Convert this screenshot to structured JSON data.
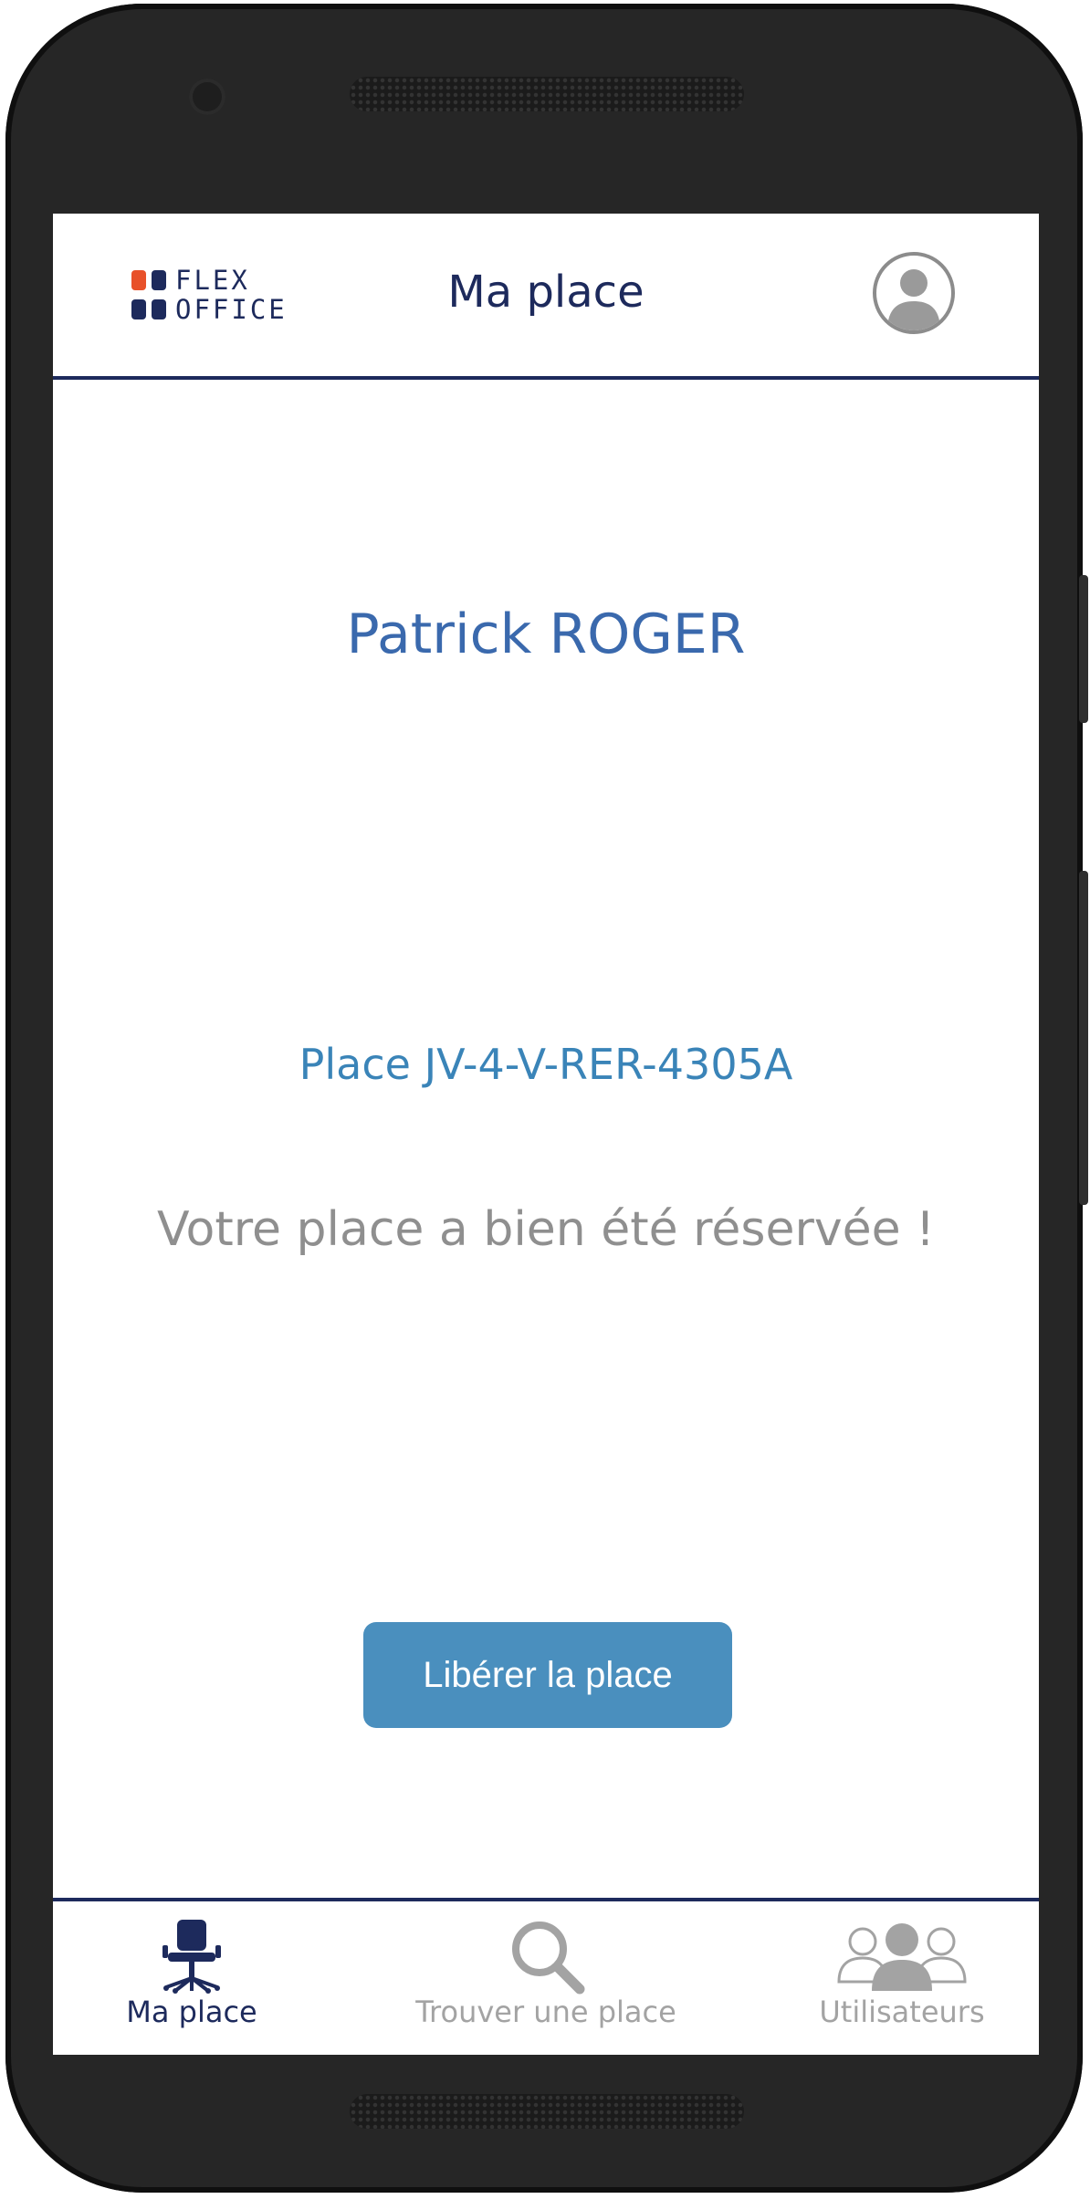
{
  "app": {
    "logo_line1": "FLEX",
    "logo_line2": "OFFICE"
  },
  "header": {
    "title": "Ma place",
    "avatar_icon": "user-avatar-icon"
  },
  "main": {
    "user_name": "Patrick ROGER",
    "place_label": "Place JV-4-V-RER-4305A",
    "status_message": "Votre place a bien été réservée !",
    "release_button_label": "Libérer la place"
  },
  "bottom_nav": {
    "items": [
      {
        "label": "Ma place",
        "icon": "office-chair-icon",
        "active": true
      },
      {
        "label": "Trouver une place",
        "icon": "search-icon",
        "active": false
      },
      {
        "label": "Utilisateurs",
        "icon": "users-icon",
        "active": false
      }
    ]
  },
  "colors": {
    "brand_dark": "#1d2a5c",
    "brand_orange": "#e8512a",
    "accent_blue": "#4a8fbe",
    "name_blue": "#3a69ad",
    "muted_gray": "#8f8f8f",
    "inactive_gray": "#a3a3a3"
  }
}
